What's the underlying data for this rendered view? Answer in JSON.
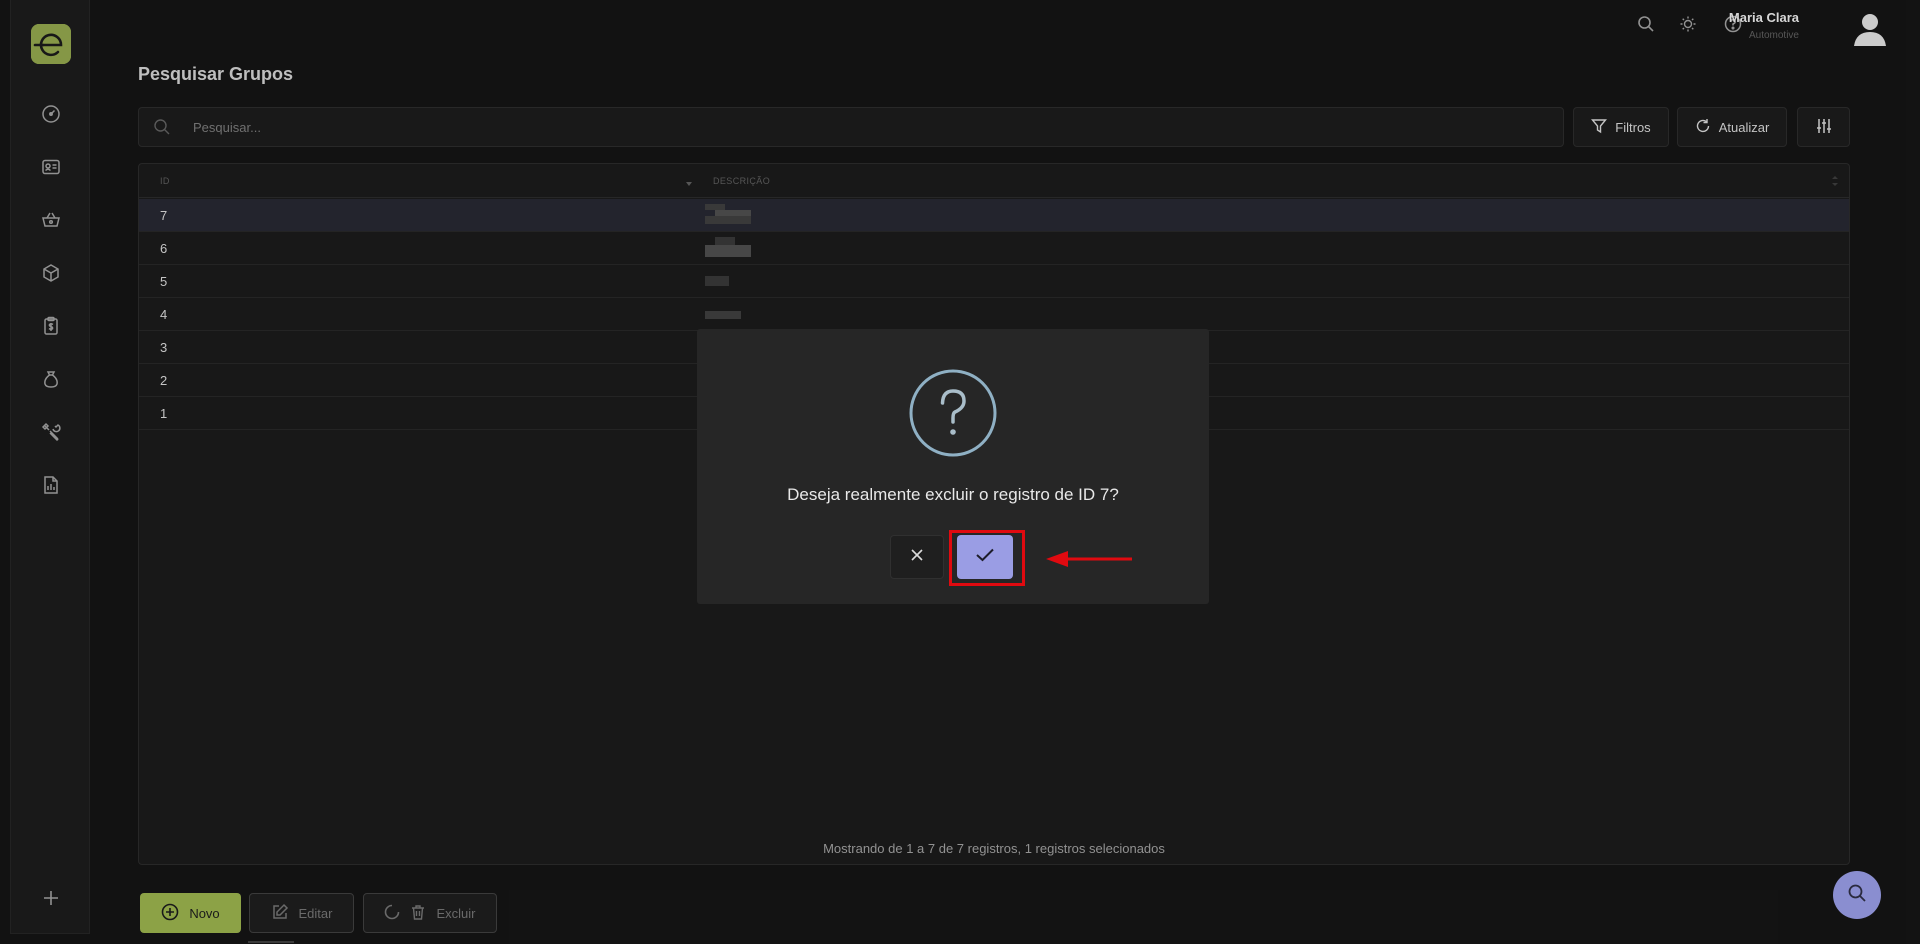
{
  "header": {
    "user_name": "Maria Clara",
    "user_org": "Automotive"
  },
  "page": {
    "title": "Pesquisar Grupos"
  },
  "search": {
    "placeholder": "Pesquisar..."
  },
  "toolbar": {
    "filters_label": "Filtros",
    "refresh_label": "Atualizar"
  },
  "table": {
    "columns": [
      "ID",
      "DESCRIÇÃO"
    ],
    "rows": [
      {
        "id": "7",
        "selected": true
      },
      {
        "id": "6",
        "selected": false
      },
      {
        "id": "5",
        "selected": false
      },
      {
        "id": "4",
        "selected": false
      },
      {
        "id": "3",
        "selected": false
      },
      {
        "id": "2",
        "selected": false
      },
      {
        "id": "1",
        "selected": false
      }
    ],
    "footer": "Mostrando de 1 a 7 de 7 registros, 1 registros selecionados"
  },
  "dialog": {
    "message": "Deseja realmente excluir o registro de ID 7?"
  },
  "footer_buttons": {
    "new_label": "Novo",
    "edit_label": "Editar",
    "delete_label": "Excluir"
  },
  "colors": {
    "brand": "#8ca246",
    "confirm": "#9a9de4",
    "highlight": "#e00a10"
  },
  "icons": {
    "sidebar": [
      "dashboard-icon",
      "id-card-icon",
      "basket-icon",
      "box-icon",
      "clipboard-dollar-icon",
      "money-bag-icon",
      "tools-icon",
      "report-icon",
      "plus-icon"
    ],
    "topbar": [
      "search-icon",
      "sun-icon",
      "help-icon",
      "avatar-icon"
    ]
  }
}
